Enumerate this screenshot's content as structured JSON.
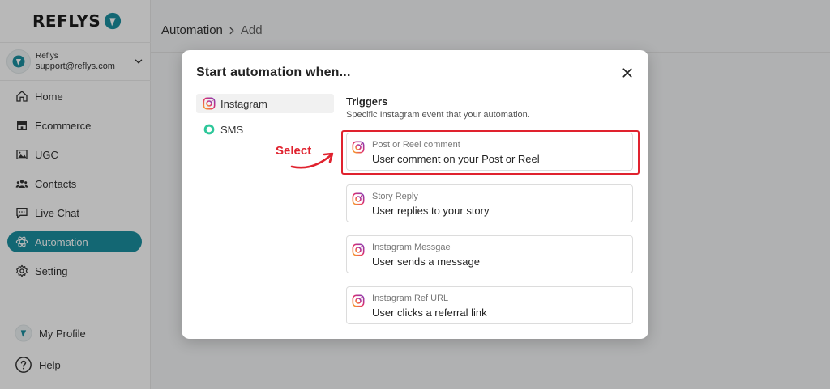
{
  "brand": {
    "name": "REFLYS",
    "accent": "#1b8fa0"
  },
  "user": {
    "name": "Reflys",
    "email": "support@reflys.com"
  },
  "nav": [
    {
      "label": "Home",
      "icon": "home-icon"
    },
    {
      "label": "Ecommerce",
      "icon": "store-icon"
    },
    {
      "label": "UGC",
      "icon": "image-icon"
    },
    {
      "label": "Contacts",
      "icon": "users-icon"
    },
    {
      "label": "Live Chat",
      "icon": "chat-icon"
    },
    {
      "label": "Automation",
      "icon": "atom-icon",
      "active": true
    },
    {
      "label": "Setting",
      "icon": "gear-icon"
    }
  ],
  "sidebar_bottom": [
    {
      "label": "My Profile",
      "icon": "avatar"
    },
    {
      "label": "Help",
      "icon": "help-icon"
    }
  ],
  "breadcrumb": {
    "root": "Automation",
    "leaf": "Add"
  },
  "modal": {
    "title": "Start automation when...",
    "channels": [
      {
        "label": "Instagram",
        "icon": "instagram-icon",
        "selected": true
      },
      {
        "label": "SMS",
        "icon": "sms-icon"
      }
    ],
    "triggers_title": "Triggers",
    "triggers_subtitle": "Specific Instagram event that your automation.",
    "triggers": [
      {
        "label": "Post or Reel comment",
        "description": "User comment on your Post or Reel",
        "highlighted": true
      },
      {
        "label": "Story Reply",
        "description": "User replies to your story"
      },
      {
        "label": "Instagram Messgae",
        "description": "User sends a message"
      },
      {
        "label": "Instagram Ref URL",
        "description": "User clicks a referral link"
      }
    ],
    "annotation": "Select",
    "annotation_color": "#e0222e"
  }
}
